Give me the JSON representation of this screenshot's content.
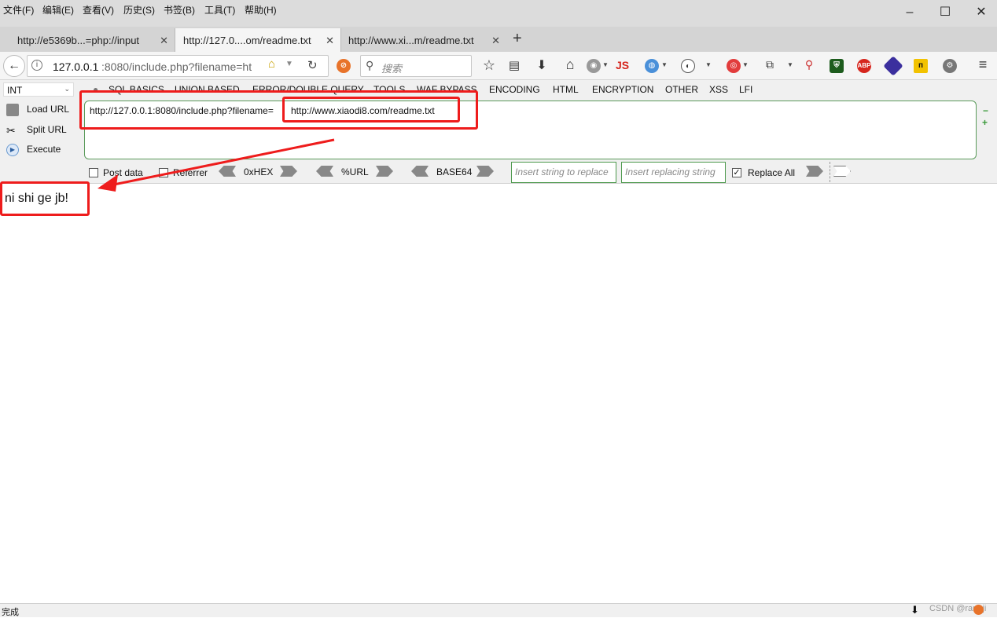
{
  "menubar": {
    "items": [
      "文件(F)",
      "编辑(E)",
      "查看(V)",
      "历史(S)",
      "书签(B)",
      "工具(T)",
      "帮助(H)"
    ]
  },
  "tabs": [
    {
      "label": "http://e5369b...=php://input"
    },
    {
      "label": "http://127.0....om/readme.txt"
    },
    {
      "label": "http://www.xi...m/readme.txt"
    }
  ],
  "navbar": {
    "url_host": "127.0.0.1",
    "url_rest": ":8080/include.php?filename=ht",
    "search_placeholder": "搜索",
    "js_label": "JS",
    "abp_label": "ABP"
  },
  "hackbar": {
    "int_select": "INT",
    "menus": [
      "SQL BASICS",
      "UNION BASED",
      "ERROR/DOUBLE QUERY",
      "TOOLS",
      "WAF BYPASS",
      "ENCODING",
      "HTML",
      "ENCRYPTION",
      "OTHER",
      "XSS",
      "LFI"
    ],
    "load_url": "Load URL",
    "split_url": "Split URL",
    "execute": "Execute",
    "url_prefix": "http://127.0.0.1:8080/include.php?filename=",
    "url_param": "http://www.xiaodi8.com/readme.txt",
    "post_data": "Post data",
    "referrer": "Referrer",
    "hex": "0xHEX",
    "url_enc": "%URL",
    "base64": "BASE64",
    "replace_placeholder": "Insert string to replace",
    "replacing_placeholder": "Insert replacing string",
    "replace_all": "Replace All"
  },
  "page": {
    "body_text": "ni shi ge jb!"
  },
  "status": {
    "text": "完成",
    "watermark": "CSDN @rannji"
  },
  "colors": {
    "annotation_red": "#ee1c1c",
    "hackbar_green": "#4e9a4e"
  }
}
